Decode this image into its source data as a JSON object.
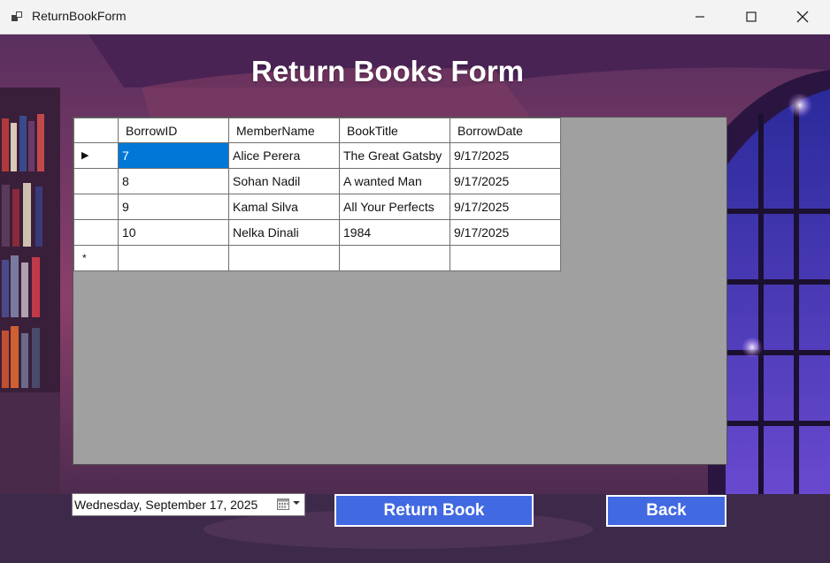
{
  "window": {
    "title": "ReturnBookForm"
  },
  "form": {
    "heading": "Return Books Form",
    "grid": {
      "columns": [
        "BorrowID",
        "MemberName",
        "BookTitle",
        "BorrowDate"
      ],
      "rows": [
        [
          "7",
          "Alice Perera",
          "The Great Gatsby",
          "9/17/2025"
        ],
        [
          "8",
          "Sohan Nadil",
          "A wanted Man",
          "9/17/2025"
        ],
        [
          "9",
          "Kamal Silva",
          "All Your Perfects",
          "9/17/2025"
        ],
        [
          "10",
          "Nelka Dinali",
          "1984",
          "9/17/2025"
        ]
      ],
      "current_row_marker": "▶",
      "new_row_marker": "*"
    },
    "date_picker": {
      "value": "Wednesday, September 17, 2025"
    },
    "return_button_label": "Return Book",
    "back_button_label": "Back"
  },
  "colors": {
    "button_bg": "#4169e1",
    "selection": "#0078d7",
    "grid_background": "#a0a0a0"
  },
  "icons": {
    "app": "window-app-icon",
    "minimize": "minimize-icon",
    "maximize": "maximize-icon",
    "close": "close-icon",
    "calendar": "calendar-icon",
    "dropdown": "chevron-down-icon"
  }
}
